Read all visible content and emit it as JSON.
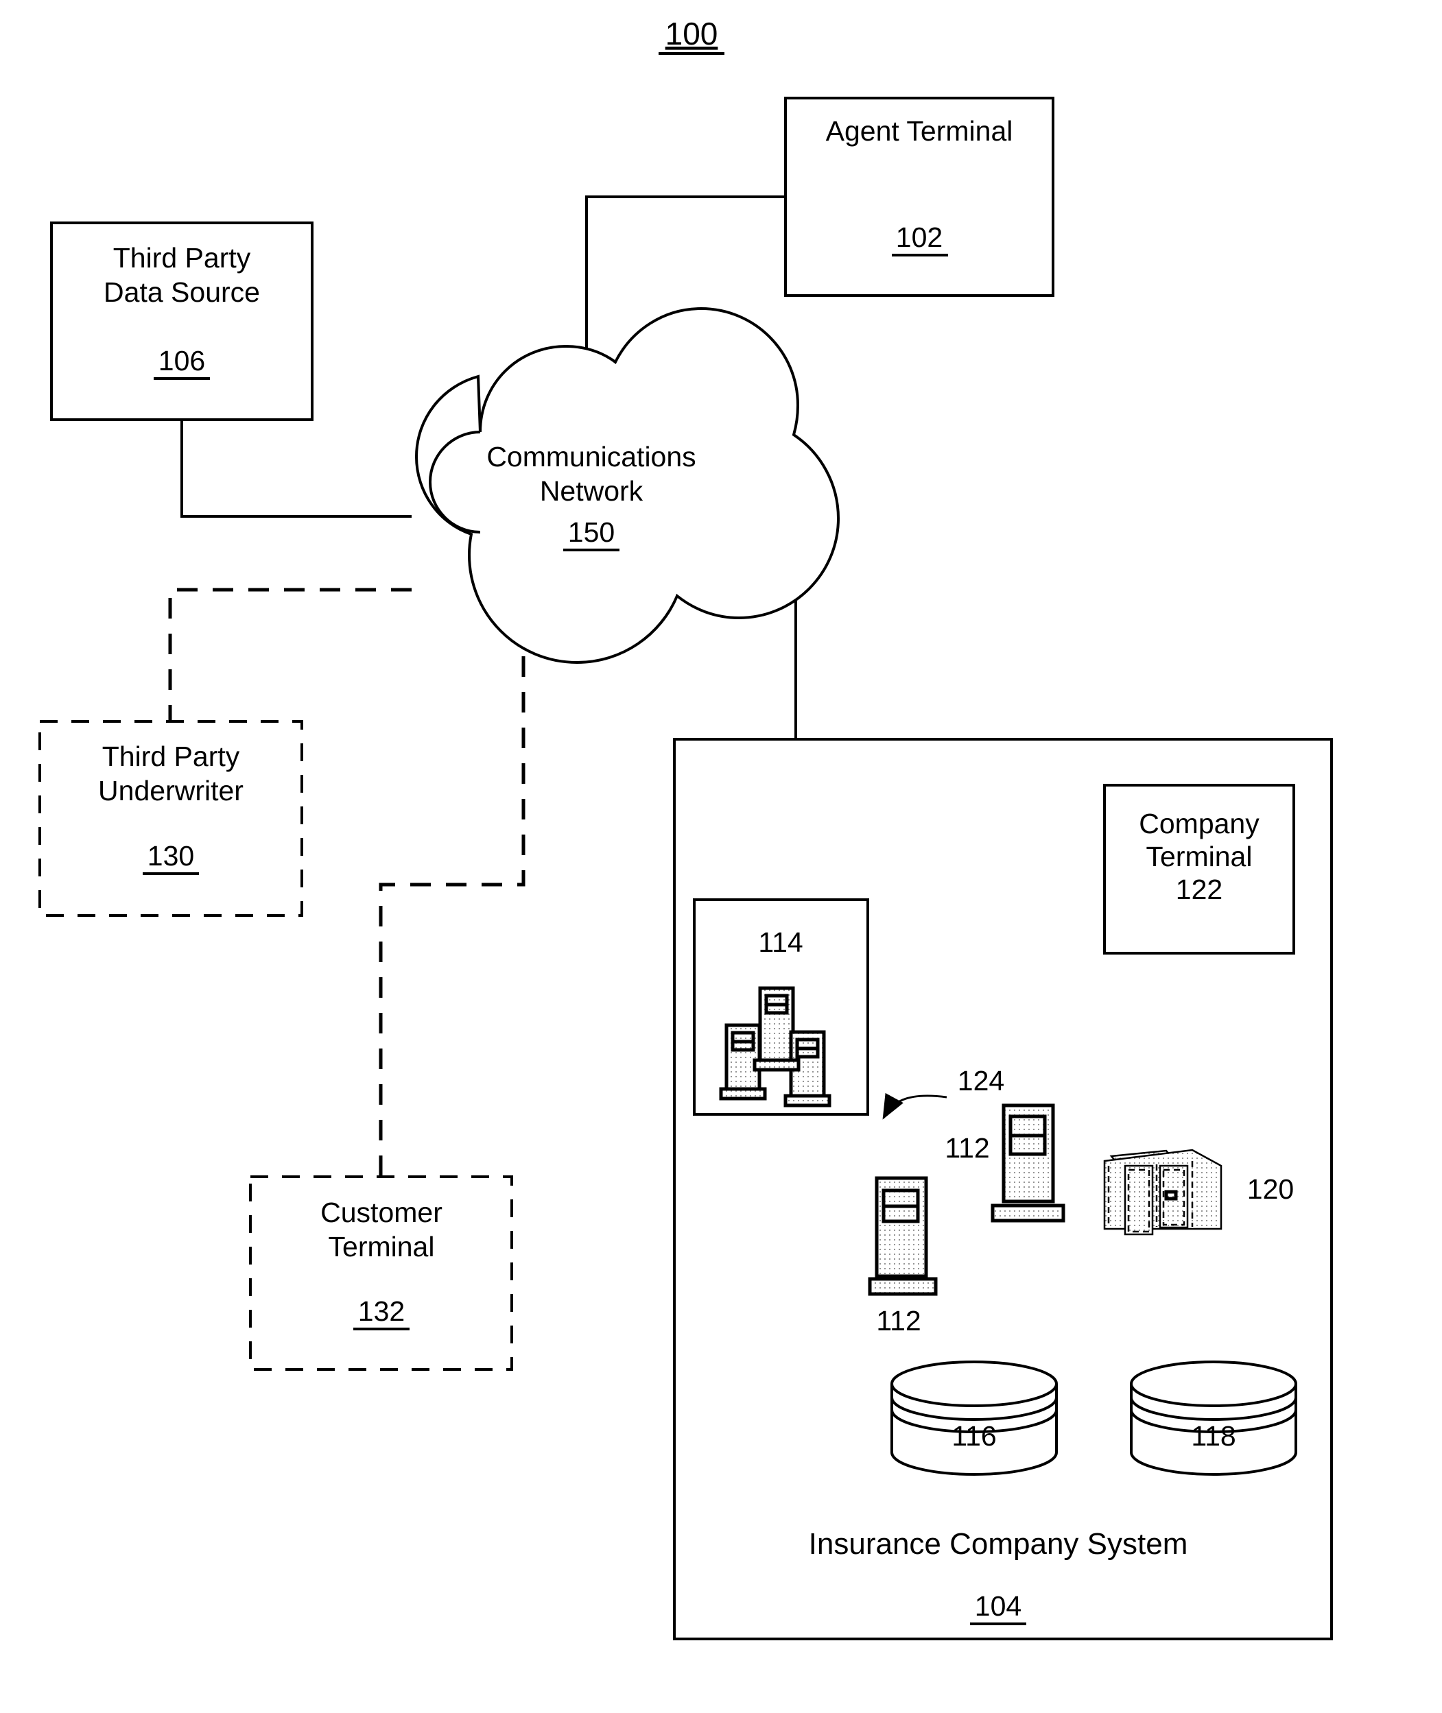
{
  "figure": {
    "number": "100",
    "caption_system": "Insurance Company System",
    "caption_system_ref": "104"
  },
  "nodes": {
    "agent_terminal": {
      "label_line1": "Agent Terminal",
      "ref": "102"
    },
    "third_party_data_source": {
      "label_line1": "Third Party",
      "label_line2": "Data Source",
      "ref": "106"
    },
    "communications_network": {
      "label_line1": "Communications",
      "label_line2": "Network",
      "ref": "150"
    },
    "third_party_underwriter": {
      "label_line1": "Third Party",
      "label_line2": "Underwriter",
      "ref": "130"
    },
    "customer_terminal": {
      "label_line1": "Customer",
      "label_line2": "Terminal",
      "ref": "132"
    },
    "company_terminal": {
      "label_line1": "Company",
      "label_line2": "Terminal",
      "ref": "122"
    },
    "server_group": {
      "ref": "114"
    },
    "workstation_left": {
      "ref": "112"
    },
    "workstation_right": {
      "ref": "112"
    },
    "network_link_callout": {
      "ref": "124"
    },
    "peripheral_device": {
      "ref": "120"
    },
    "database_left": {
      "ref": "116"
    },
    "database_right": {
      "ref": "118"
    }
  },
  "colors": {
    "stroke": "#000000",
    "background": "#ffffff",
    "device_fill": "#e8e8e8"
  }
}
